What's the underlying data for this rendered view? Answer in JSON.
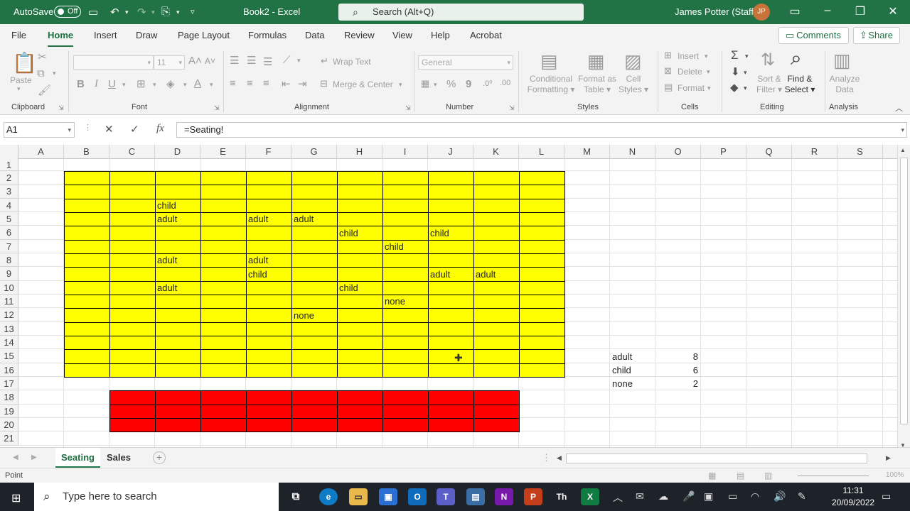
{
  "titlebar": {
    "autosave_label": "AutoSave",
    "autosave_state": "Off",
    "doc_title": "Book2 - Excel",
    "search_placeholder": "Search (Alt+Q)",
    "user_name": "James Potter (Staff)",
    "user_initials": "JP"
  },
  "tabs": [
    "File",
    "Home",
    "Insert",
    "Draw",
    "Page Layout",
    "Formulas",
    "Data",
    "Review",
    "View",
    "Help",
    "Acrobat"
  ],
  "active_tab": "Home",
  "ribbon_buttons": {
    "comments": "Comments",
    "share": "Share"
  },
  "ribbon": {
    "clipboard": {
      "label": "Clipboard",
      "paste": "Paste"
    },
    "font": {
      "label": "Font",
      "font_name": "",
      "font_size": "11"
    },
    "alignment": {
      "label": "Alignment",
      "wrap_text": "Wrap Text",
      "merge_center": "Merge & Center"
    },
    "number": {
      "label": "Number",
      "format": "General"
    },
    "styles": {
      "label": "Styles",
      "conditional_1": "Conditional",
      "conditional_2": "Formatting",
      "format_table_1": "Format as",
      "format_table_2": "Table",
      "cell_styles_1": "Cell",
      "cell_styles_2": "Styles"
    },
    "cells": {
      "label": "Cells",
      "insert": "Insert",
      "delete": "Delete",
      "format": "Format"
    },
    "editing": {
      "label": "Editing",
      "sort_1": "Sort &",
      "sort_2": "Filter",
      "find_1": "Find &",
      "find_2": "Select"
    },
    "analysis": {
      "label": "Analysis",
      "analyze_1": "Analyze",
      "analyze_2": "Data"
    }
  },
  "formula_bar": {
    "name_box": "A1",
    "formula": "=Seating!"
  },
  "columns": [
    "A",
    "B",
    "C",
    "D",
    "E",
    "F",
    "G",
    "H",
    "I",
    "J",
    "K",
    "L",
    "M",
    "N",
    "O",
    "P",
    "Q",
    "R",
    "S"
  ],
  "rows": [
    "1",
    "2",
    "3",
    "4",
    "5",
    "6",
    "7",
    "8",
    "9",
    "10",
    "11",
    "12",
    "13",
    "14",
    "15",
    "16",
    "17",
    "18",
    "19",
    "20",
    "21"
  ],
  "cells": [
    {
      "ref": "D4",
      "value": "child"
    },
    {
      "ref": "D5",
      "value": "adult"
    },
    {
      "ref": "F5",
      "value": "adult"
    },
    {
      "ref": "G5",
      "value": "adult"
    },
    {
      "ref": "H6",
      "value": "child"
    },
    {
      "ref": "J6",
      "value": "child"
    },
    {
      "ref": "I7",
      "value": "child"
    },
    {
      "ref": "D8",
      "value": "adult"
    },
    {
      "ref": "F8",
      "value": "adult"
    },
    {
      "ref": "F9",
      "value": "child"
    },
    {
      "ref": "J9",
      "value": "adult"
    },
    {
      "ref": "K9",
      "value": "adult"
    },
    {
      "ref": "D10",
      "value": "adult"
    },
    {
      "ref": "H10",
      "value": "child"
    },
    {
      "ref": "I11",
      "value": "none"
    },
    {
      "ref": "G12",
      "value": "none"
    },
    {
      "ref": "N15",
      "value": "adult"
    },
    {
      "ref": "O15",
      "value": "8",
      "numeric": true
    },
    {
      "ref": "N16",
      "value": "child"
    },
    {
      "ref": "O16",
      "value": "6",
      "numeric": true
    },
    {
      "ref": "N17",
      "value": "none"
    },
    {
      "ref": "O17",
      "value": "2",
      "numeric": true
    }
  ],
  "fill_colors": {
    "yellow": "#ffff00",
    "red": "#ff0000",
    "accent": "#217346"
  },
  "sheet_tabs": [
    "Seating",
    "Sales"
  ],
  "active_sheet": "Seating",
  "status": {
    "mode": "Point",
    "zoom": "100%"
  },
  "taskbar": {
    "search_placeholder": "Type here to search",
    "time": "11:31",
    "date": "20/09/2022"
  }
}
